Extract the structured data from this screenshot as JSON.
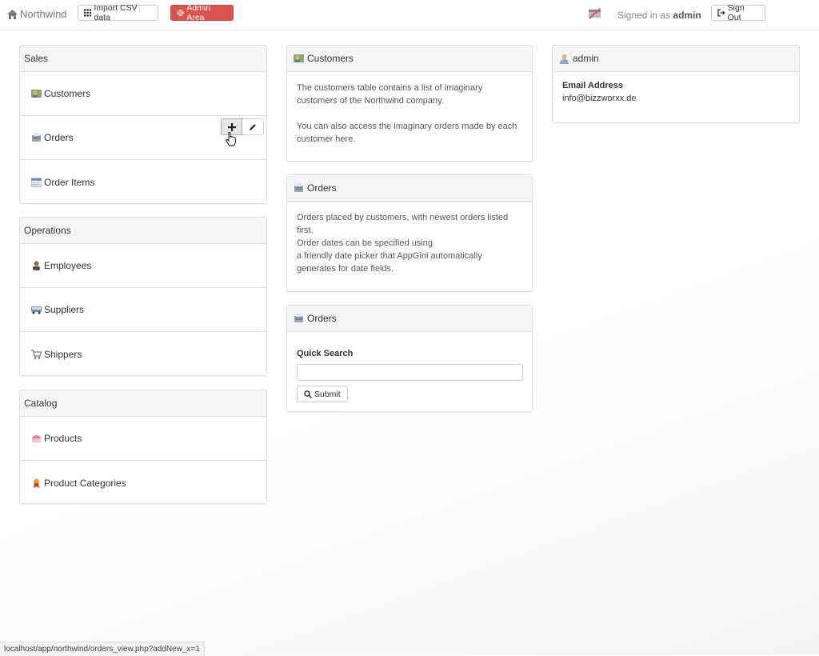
{
  "nav": {
    "brand": "Northwind",
    "import_label": "Import CSV data",
    "admin_label": "Admin Area",
    "signed_prefix": "Signed in as",
    "signed_user": "admin",
    "signout_label": "Sign Out"
  },
  "sales": {
    "title": "Sales",
    "items": [
      {
        "label": "Customers",
        "icon": "customers-icon"
      },
      {
        "label": "Orders",
        "icon": "orders-icon"
      },
      {
        "label": "Order Items",
        "icon": "order-items-icon"
      }
    ]
  },
  "operations": {
    "title": "Operations",
    "items": [
      {
        "label": "Employees",
        "icon": "employees-icon"
      },
      {
        "label": "Suppliers",
        "icon": "suppliers-icon"
      },
      {
        "label": "Shippers",
        "icon": "shippers-icon"
      }
    ]
  },
  "catalog": {
    "title": "Catalog",
    "items": [
      {
        "label": "Products",
        "icon": "products-icon"
      },
      {
        "label": "Product Categories",
        "icon": "product-categories-icon"
      }
    ]
  },
  "customers_info": {
    "title": "Customers",
    "line1": "The customers table contains a list of imaginary customers of the Northwind company.",
    "line2": "You can also access the imaginary orders made by each customer here."
  },
  "orders_info": {
    "title": "Orders",
    "line1": "Orders placed by customers, with newest orders listed first.",
    "line2": "Order dates can be specified using",
    "line3": "a friendly date picker that AppGini automatically generates for date fields."
  },
  "orders_search": {
    "title": "Orders",
    "label": "Quick Search",
    "input_value": "",
    "submit_label": "Submit"
  },
  "admin_panel": {
    "title": "admin",
    "email_label": "Email Address",
    "email_value": "info@bizzworxx.de"
  },
  "status_url": "localhost/app/northwind/orders_view.php?addNew_x=1",
  "colors": {
    "danger": "#d9534f",
    "panel_heading_bg": "#f5f5f5",
    "border": "#dddddd"
  }
}
